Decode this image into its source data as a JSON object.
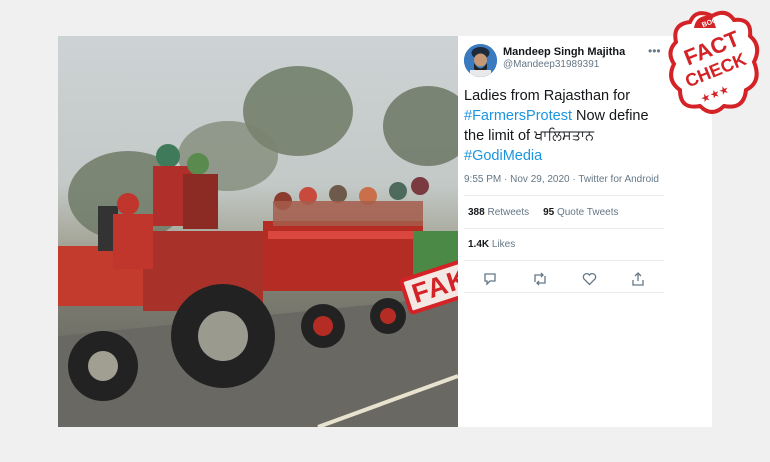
{
  "stamp": {
    "fake_label": "FAKE"
  },
  "tweet": {
    "author_name": "Mandeep Singh Majitha",
    "author_handle": "@Mandeep31989391",
    "text_line1": "Ladies from Rajasthan for",
    "hashtag1": "#FarmersProtest",
    "text_line2": " Now define",
    "text_line3": "the limit of ਖਾਲਿਸਤਾਨ",
    "hashtag2": "#GodiMedia",
    "timestamp": "9:55 PM · Nov 29, 2020 · Twitter for Android",
    "retweets_count": "388",
    "retweets_label": " Retweets",
    "quote_count": "95",
    "quote_label": " Quote Tweets",
    "likes_count": "1.4K",
    "likes_label": " Likes"
  },
  "badge": {
    "top_label": "BOOM",
    "line1": "FACT",
    "line2": "CHECK",
    "stars": "★★★"
  },
  "icons": [
    "more-icon",
    "reply-icon",
    "retweet-icon",
    "like-icon",
    "share-icon"
  ],
  "colors": {
    "link": "#1b95e0",
    "stamp_red": "#d42327",
    "badge_red": "#d42327"
  }
}
